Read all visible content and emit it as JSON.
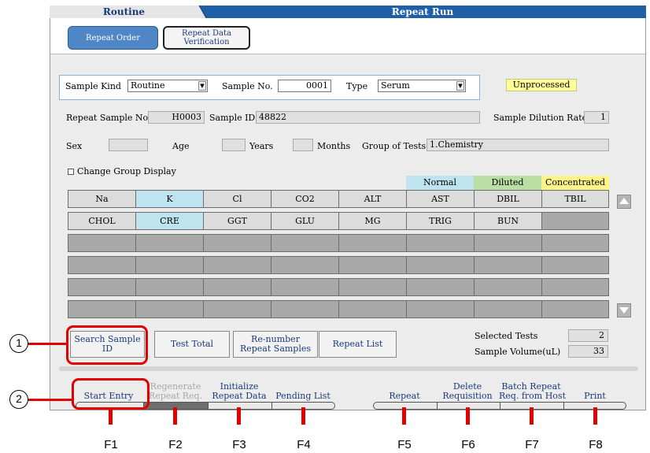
{
  "window": {
    "tab_mode": "Routine",
    "title": "Repeat Run",
    "mode_buttons": [
      "Repeat Order",
      "Repeat Data Verification"
    ]
  },
  "criteria": {
    "sample_kind_label": "Sample Kind",
    "sample_kind_value": "Routine",
    "sample_no_label": "Sample No.",
    "sample_no_value": "0001",
    "type_label": "Type",
    "type_value": "Serum",
    "status_badge": "Unprocessed"
  },
  "info": {
    "repeat_sample_no_label": "Repeat Sample No.",
    "repeat_sample_no_value": "H0003",
    "sample_id_label": "Sample ID",
    "sample_id_value": "48822",
    "dilution_label": "Sample Dilution Rate",
    "dilution_value": "1",
    "sex_label": "Sex",
    "age_label": "Age",
    "years_label": "Years",
    "months_label": "Months",
    "group_label": "Group of Tests",
    "group_value": "1.Chemistry",
    "change_group_label": "Change Group Display"
  },
  "legend": {
    "normal": "Normal",
    "diluted": "Diluted",
    "concentrated": "Concentrated",
    "colors": {
      "normal": "#bfe4ef",
      "diluted": "#b9dfa4",
      "concentrated": "#fff48a"
    }
  },
  "tests": {
    "row1": [
      "Na",
      "K",
      "Cl",
      "CO2",
      "ALT",
      "AST",
      "DBIL",
      "TBIL"
    ],
    "row2": [
      "CHOL",
      "CRE",
      "GGT",
      "GLU",
      "MG",
      "TRIG",
      "BUN",
      ""
    ],
    "highlighted": [
      "K",
      "CRE"
    ]
  },
  "actions": {
    "search": "Search Sample ID",
    "test_total": "Test Total",
    "renumber_l1": "Re-number",
    "renumber_l2": "Repeat Samples",
    "repeat_list": "Repeat List",
    "selected_tests_label": "Selected Tests",
    "selected_tests_value": "2",
    "sample_volume_label": "Sample Volume(uL)",
    "sample_volume_value": "33"
  },
  "fkeys": {
    "f1": "Start Entry",
    "f2_l1": "Regenerate",
    "f2_l2": "Repeat Req.",
    "f3_l1": "Initialize",
    "f3_l2": "Repeat Data",
    "f4": "Pending List",
    "f5": "Repeat",
    "f6_l1": "Delete",
    "f6_l2": "Requisition",
    "f7_l1": "Batch Repeat",
    "f7_l2": "Req. from Host",
    "f8": "Print"
  },
  "fkey_numbers": [
    "F1",
    "F2",
    "F3",
    "F4",
    "F5",
    "F6",
    "F7",
    "F8"
  ],
  "callouts": [
    "1",
    "2"
  ],
  "accent": "#e00000"
}
